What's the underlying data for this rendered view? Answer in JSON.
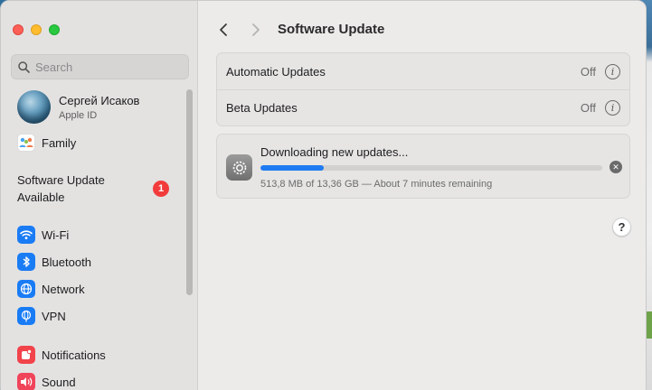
{
  "window": {
    "title": "Software Update"
  },
  "sidebar": {
    "search_placeholder": "Search",
    "account": {
      "name": "Сергей Исаков",
      "subtitle": "Apple ID"
    },
    "family_label": "Family",
    "software_update": {
      "label": "Software Update Available",
      "badge": "1"
    },
    "items": [
      {
        "label": "Wi-Fi",
        "icon": "wifi-icon"
      },
      {
        "label": "Bluetooth",
        "icon": "bluetooth-icon"
      },
      {
        "label": "Network",
        "icon": "network-globe-icon"
      },
      {
        "label": "VPN",
        "icon": "vpn-globe-icon"
      },
      {
        "label": "Notifications",
        "icon": "notifications-icon"
      },
      {
        "label": "Sound",
        "icon": "sound-icon"
      }
    ]
  },
  "settings": {
    "automatic_updates": {
      "label": "Automatic Updates",
      "value": "Off"
    },
    "beta_updates": {
      "label": "Beta Updates",
      "value": "Off"
    }
  },
  "download": {
    "title": "Downloading new updates...",
    "progress_fraction": 0.185,
    "detail": "513,8 MB of 13,36 GB — About 7 minutes remaining"
  },
  "help_label": "?",
  "colors": {
    "accent": "#1e7bf2",
    "badge": "#f23c3c",
    "close": "#fe5f57",
    "minimize": "#febc2e",
    "zoom": "#28c840"
  }
}
